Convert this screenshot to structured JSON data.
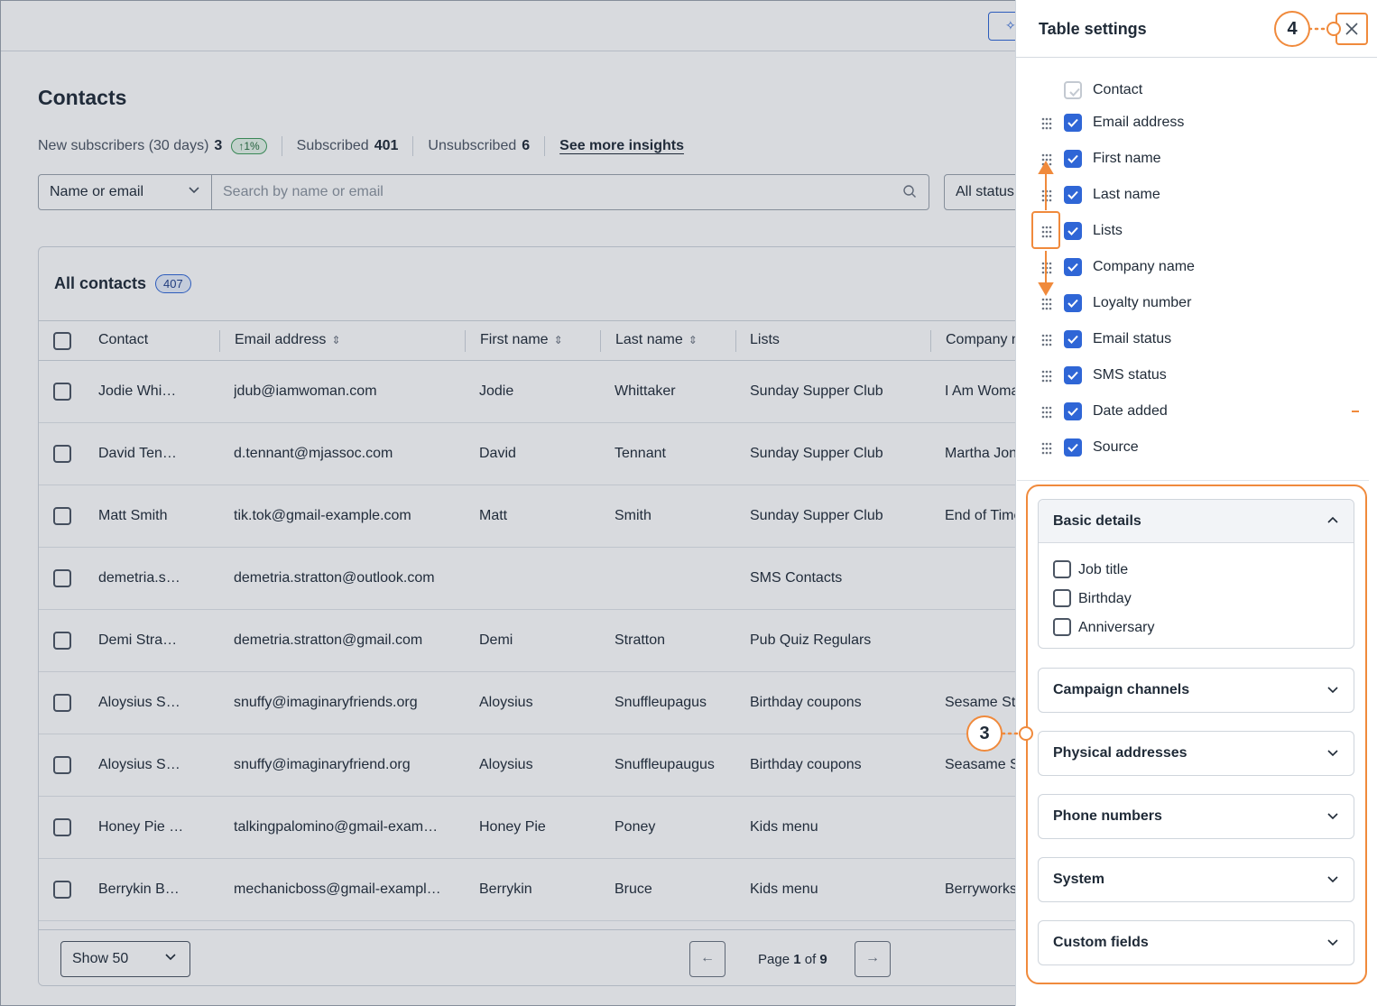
{
  "topbar": {
    "button_icon": "sparkle-icon"
  },
  "page": {
    "title": "Contacts",
    "stats": {
      "new_label": "New subscribers (30 days)",
      "new_value": "3",
      "new_pct": "↑1%",
      "subscribed_label": "Subscribed",
      "subscribed_value": "401",
      "unsubscribed_label": "Unsubscribed",
      "unsubscribed_value": "6",
      "insights_link": "See more insights"
    },
    "filter": {
      "field_select": "Name or email",
      "search_placeholder": "Search by name or email",
      "status_select": "All status"
    }
  },
  "table": {
    "title": "All contacts",
    "count": "407",
    "columns": [
      "Contact",
      "Email address",
      "First name",
      "Last name",
      "Lists",
      "Company name"
    ],
    "rows": [
      {
        "contact": "Jodie Whi…",
        "email": "jdub@iamwoman.com",
        "first": "Jodie",
        "last": "Whittaker",
        "lists": "Sunday Supper Club",
        "company": "I Am Woman"
      },
      {
        "contact": "David Ten…",
        "email": "d.tennant@mjassoc.com",
        "first": "David",
        "last": "Tennant",
        "lists": "Sunday Supper Club",
        "company": "Martha Jones"
      },
      {
        "contact": "Matt Smith",
        "email": "tik.tok@gmail-example.com",
        "first": "Matt",
        "last": "Smith",
        "lists": "Sunday Supper Club",
        "company": "End of Time"
      },
      {
        "contact": "demetria.s…",
        "email": "demetria.stratton@outlook.com",
        "first": "",
        "last": "",
        "lists": "SMS Contacts",
        "company": ""
      },
      {
        "contact": "Demi Stra…",
        "email": "demetria.stratton@gmail.com",
        "first": "Demi",
        "last": "Stratton",
        "lists": "Pub Quiz Regulars",
        "company": ""
      },
      {
        "contact": "Aloysius S…",
        "email": "snuffy@imaginaryfriends.org",
        "first": "Aloysius",
        "last": "Snuffleupagus",
        "lists": "Birthday coupons",
        "company": "Sesame Street"
      },
      {
        "contact": "Aloysius S…",
        "email": "snuffy@imaginaryfriend.org",
        "first": "Aloysius",
        "last": "Snuffleupaugus",
        "lists": "Birthday coupons",
        "company": "Seasame Street"
      },
      {
        "contact": "Honey Pie …",
        "email": "talkingpalomino@gmail-exam…",
        "first": "Honey Pie",
        "last": "Poney",
        "lists": "Kids menu",
        "company": ""
      },
      {
        "contact": "Berrykin B…",
        "email": "mechanicboss@gmail-exampl…",
        "first": "Berrykin",
        "last": "Bruce",
        "lists": "Kids menu",
        "company": "Berryworks"
      }
    ],
    "footer": {
      "show_select": "Show 50",
      "page_prefix": "Page",
      "page_current": "1",
      "page_of": "of",
      "page_total": "9"
    }
  },
  "drawer": {
    "title": "Table settings",
    "columns": [
      {
        "label": "Contact",
        "checked": true,
        "locked": true
      },
      {
        "label": "Email address",
        "checked": true
      },
      {
        "label": "First name",
        "checked": true
      },
      {
        "label": "Last name",
        "checked": true
      },
      {
        "label": "Lists",
        "checked": true
      },
      {
        "label": "Company name",
        "checked": true
      },
      {
        "label": "Loyalty number",
        "checked": true
      },
      {
        "label": "Email status",
        "checked": true
      },
      {
        "label": "SMS status",
        "checked": true
      },
      {
        "label": "Date added",
        "checked": true
      },
      {
        "label": "Source",
        "checked": true
      }
    ],
    "sections": [
      {
        "title": "Basic details",
        "expanded": true,
        "options": [
          "Job title",
          "Birthday",
          "Anniversary"
        ]
      },
      {
        "title": "Campaign channels",
        "expanded": false
      },
      {
        "title": "Physical addresses",
        "expanded": false
      },
      {
        "title": "Phone numbers",
        "expanded": false
      },
      {
        "title": "System",
        "expanded": false
      },
      {
        "title": "Custom fields",
        "expanded": false
      }
    ]
  },
  "annotations": {
    "callout_close": "4",
    "callout_sections": "3"
  },
  "colors": {
    "accent": "#2f66d6",
    "annotation": "#f08a3c",
    "success": "#3d9a5a"
  }
}
